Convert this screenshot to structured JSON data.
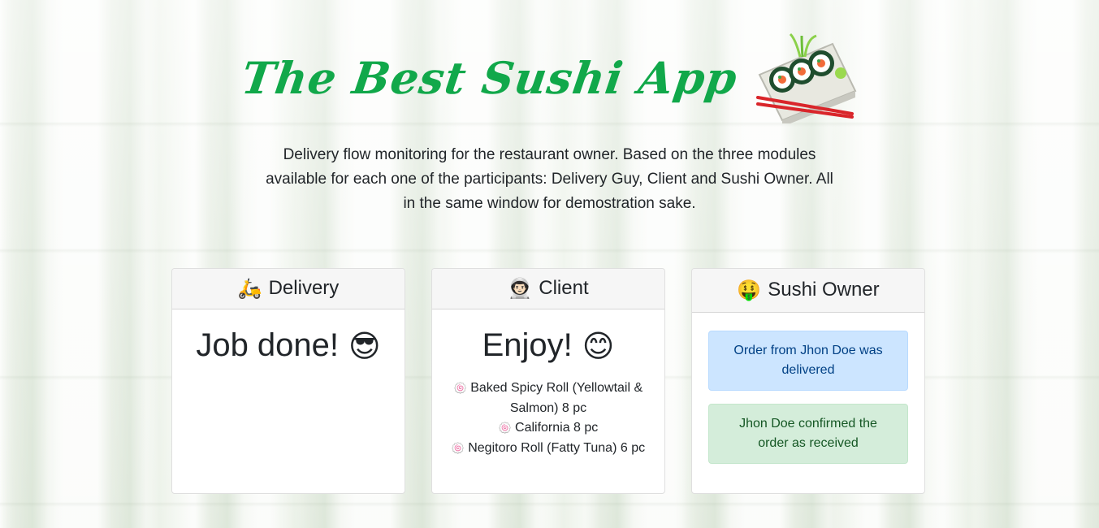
{
  "header": {
    "title": "The Best Sushi App",
    "description": "Delivery flow monitoring for the restaurant owner. Based on the three modules available for each one of the participants: Delivery Guy, Client and Sushi Owner. All in the same window for demostration sake."
  },
  "delivery": {
    "emoji": "🛵",
    "title": "Delivery",
    "status": "Job done!",
    "status_emoji": "😎"
  },
  "client": {
    "emoji": "👨🏻‍🚀",
    "title": "Client",
    "status": "Enjoy!",
    "status_emoji": "😊",
    "items": [
      "Baked Spicy Roll (Yellowtail & Salmon) 8 pc",
      "California 8 pc",
      "Negitoro Roll (Fatty Tuna) 6 pc"
    ]
  },
  "owner": {
    "emoji": "🤑",
    "title": "Sushi Owner",
    "alerts": [
      "Order from Jhon Doe was delivered",
      "Jhon Doe confirmed the order as received"
    ]
  },
  "colors": {
    "title_green": "#11a84a",
    "info_bg": "#cce5ff",
    "success_bg": "#d4edda"
  }
}
